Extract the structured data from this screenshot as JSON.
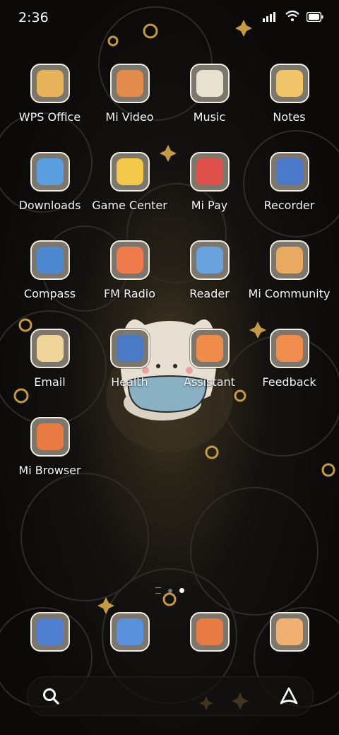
{
  "status": {
    "time": "2:36"
  },
  "apps": [
    {
      "label": "WPS Office",
      "icon": "wps-icon",
      "color": "#e6b25a"
    },
    {
      "label": "Mi Video",
      "icon": "video-icon",
      "color": "#e38b4a"
    },
    {
      "label": "Music",
      "icon": "music-icon",
      "color": "#e9e1cf"
    },
    {
      "label": "Notes",
      "icon": "notes-icon",
      "color": "#f2c46a"
    },
    {
      "label": "Downloads",
      "icon": "download-icon",
      "color": "#5b9ee0"
    },
    {
      "label": "Game Center",
      "icon": "pacman-icon",
      "color": "#f4c84a"
    },
    {
      "label": "Mi Pay",
      "icon": "wallet-icon",
      "color": "#e0504a"
    },
    {
      "label": "Recorder",
      "icon": "radio-icon",
      "color": "#4b79c9"
    },
    {
      "label": "Compass",
      "icon": "compass-icon",
      "color": "#4e88d1"
    },
    {
      "label": "FM Radio",
      "icon": "fm-radio-icon",
      "color": "#ef7a4c"
    },
    {
      "label": "Reader",
      "icon": "book-icon",
      "color": "#6aa2de"
    },
    {
      "label": "Mi Community",
      "icon": "box-icon",
      "color": "#e9a960"
    },
    {
      "label": "Email",
      "icon": "envelope-icon",
      "color": "#f0d59a"
    },
    {
      "label": "Health",
      "icon": "health-icon",
      "color": "#4a79c6"
    },
    {
      "label": "Assistant",
      "icon": "assistant-icon",
      "color": "#f08c4a"
    },
    {
      "label": "Feedback",
      "icon": "feedback-icon",
      "color": "#ef8c4e"
    },
    {
      "label": "Mi Browser",
      "icon": "browser-icon",
      "color": "#e87a44"
    }
  ],
  "dock": [
    {
      "label": "",
      "icon": "phone-cat-icon",
      "color": "#4e7fd0"
    },
    {
      "label": "",
      "icon": "messages-icon",
      "color": "#5a91dc"
    },
    {
      "label": "",
      "icon": "browser-icon",
      "color": "#e87a44"
    },
    {
      "label": "",
      "icon": "camera-icon",
      "color": "#f0b071"
    }
  ],
  "page_indicator": {
    "count": 2,
    "active": 2
  }
}
